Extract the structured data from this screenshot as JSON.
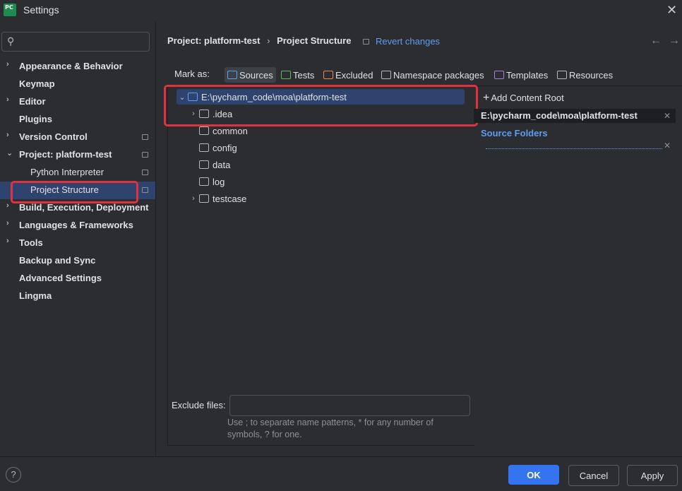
{
  "window": {
    "title": "Settings"
  },
  "search": {
    "placeholder": ""
  },
  "sidebar": {
    "items": [
      {
        "label": "Appearance & Behavior",
        "expandable": true
      },
      {
        "label": "Keymap",
        "expandable": false
      },
      {
        "label": "Editor",
        "expandable": true
      },
      {
        "label": "Plugins",
        "expandable": false
      },
      {
        "label": "Version Control",
        "expandable": true
      },
      {
        "label": "Project: platform-test",
        "expandable": true,
        "expanded": true
      },
      {
        "label": "Python Interpreter",
        "child": true
      },
      {
        "label": "Project Structure",
        "child": true,
        "selected": true
      },
      {
        "label": "Build, Execution, Deployment",
        "expandable": true
      },
      {
        "label": "Languages & Frameworks",
        "expandable": true
      },
      {
        "label": "Tools",
        "expandable": true
      },
      {
        "label": "Backup and Sync",
        "expandable": false
      },
      {
        "label": "Advanced Settings",
        "expandable": false
      },
      {
        "label": "Lingma",
        "expandable": false
      }
    ]
  },
  "header": {
    "breadcrumb_parent": "Project: platform-test",
    "breadcrumb_sep": "›",
    "breadcrumb_current": "Project Structure",
    "revert": "Revert changes"
  },
  "markas": {
    "label": "Mark as:",
    "buttons": [
      {
        "label": "Sources",
        "color": "#5e9df2"
      },
      {
        "label": "Tests",
        "color": "#5fb865"
      },
      {
        "label": "Excluded",
        "color": "#e08855"
      },
      {
        "label": "Namespace packages",
        "color": "#b4b8bf"
      },
      {
        "label": "Templates",
        "color": "#a77fd9"
      },
      {
        "label": "Resources",
        "color": "#b4b8bf"
      }
    ]
  },
  "tree": {
    "rows": [
      {
        "label": "E:\\pycharm_code\\moa\\platform-test",
        "arrow": "⌄",
        "selected": true
      },
      {
        "label": ".idea",
        "arrow": "›"
      },
      {
        "label": "common",
        "arrow": ""
      },
      {
        "label": "config",
        "arrow": ""
      },
      {
        "label": "data",
        "arrow": ""
      },
      {
        "label": "log",
        "arrow": ""
      },
      {
        "label": "testcase",
        "arrow": "›"
      }
    ]
  },
  "content_root": {
    "add_label": "Add Content Root",
    "path": "E:\\pycharm_code\\moa\\platform-test",
    "source_folders_label": "Source Folders"
  },
  "exclude": {
    "label": "Exclude files:",
    "value": "",
    "hint": "Use ; to separate name patterns, * for any number of symbols, ? for one."
  },
  "footer": {
    "help": "?",
    "ok": "OK",
    "cancel": "Cancel",
    "apply": "Apply"
  }
}
